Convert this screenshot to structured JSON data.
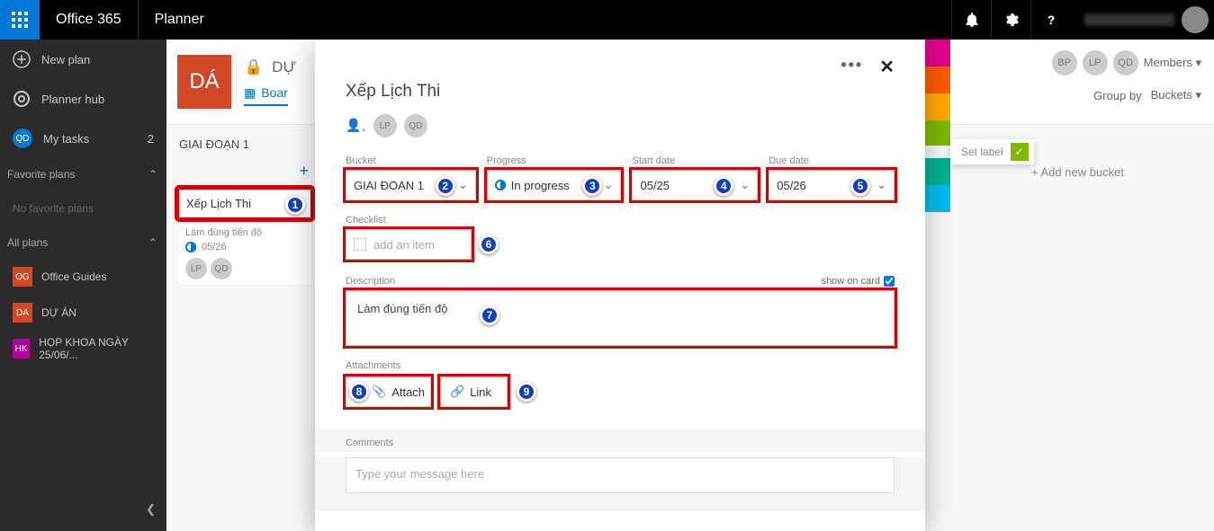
{
  "topbar": {
    "brand": "Office 365",
    "app": "Planner"
  },
  "leftnav": {
    "new_plan": "New plan",
    "planner_hub": "Planner hub",
    "my_tasks": "My tasks",
    "my_tasks_count": "2",
    "my_tasks_initials": "QD",
    "favorite_head": "Favorite plans",
    "no_fav": "No favorite plans",
    "all_head": "All plans",
    "plans": [
      {
        "abbr": "OG",
        "color": "#d24726",
        "name": "Office Guides"
      },
      {
        "abbr": "DA",
        "color": "#d24726",
        "name": "DỰ ÁN"
      },
      {
        "abbr": "HK",
        "color": "#b4009e",
        "name": "HỌP KHOA NGÀY 25/06/..."
      }
    ]
  },
  "plan": {
    "badge": "DÁ",
    "title": "DỰ",
    "tabs": {
      "board": "Boar"
    },
    "avatars": [
      "BP",
      "LP",
      "QD"
    ],
    "members": "Members",
    "group_by_label": "Group by",
    "group_by_value": "Buckets",
    "add_bucket": "+ Add new bucket"
  },
  "bucket": {
    "name": "GIAI ĐOẠN 1",
    "task": {
      "name": "Xếp Lịch Thi",
      "desc_preview": "Làm đúng tiến độ",
      "due": "05/26",
      "avs": [
        "LP",
        "QD"
      ]
    }
  },
  "modal": {
    "title": "Xếp Lịch Thi",
    "assignees": [
      "LP",
      "QD"
    ],
    "fields": {
      "bucket_label": "Bucket",
      "bucket_value": "GIAI ĐOẠN 1",
      "progress_label": "Progress",
      "progress_value": "In progress",
      "start_label": "Start date",
      "start_value": "05/25",
      "due_label": "Due date",
      "due_value": "05/26"
    },
    "checklist_label": "Checklist",
    "checklist_placeholder": "add an item",
    "description_label": "Description",
    "show_on_card": "show on card",
    "description_value": "Làm đúng tiến độ",
    "attachments_label": "Attachments",
    "attach_btn": "Attach",
    "link_btn": "Link",
    "comments_label": "Comments",
    "comments_placeholder": "Type your message here"
  },
  "labels": {
    "colors": [
      "#e3008c",
      "#ff8c00",
      "#ffb900",
      "#7fba00",
      "#00b294",
      "#00bcf2"
    ],
    "set_label": "Set label"
  },
  "annotations": [
    "1",
    "2",
    "3",
    "4",
    "5",
    "6",
    "7",
    "8",
    "9"
  ]
}
